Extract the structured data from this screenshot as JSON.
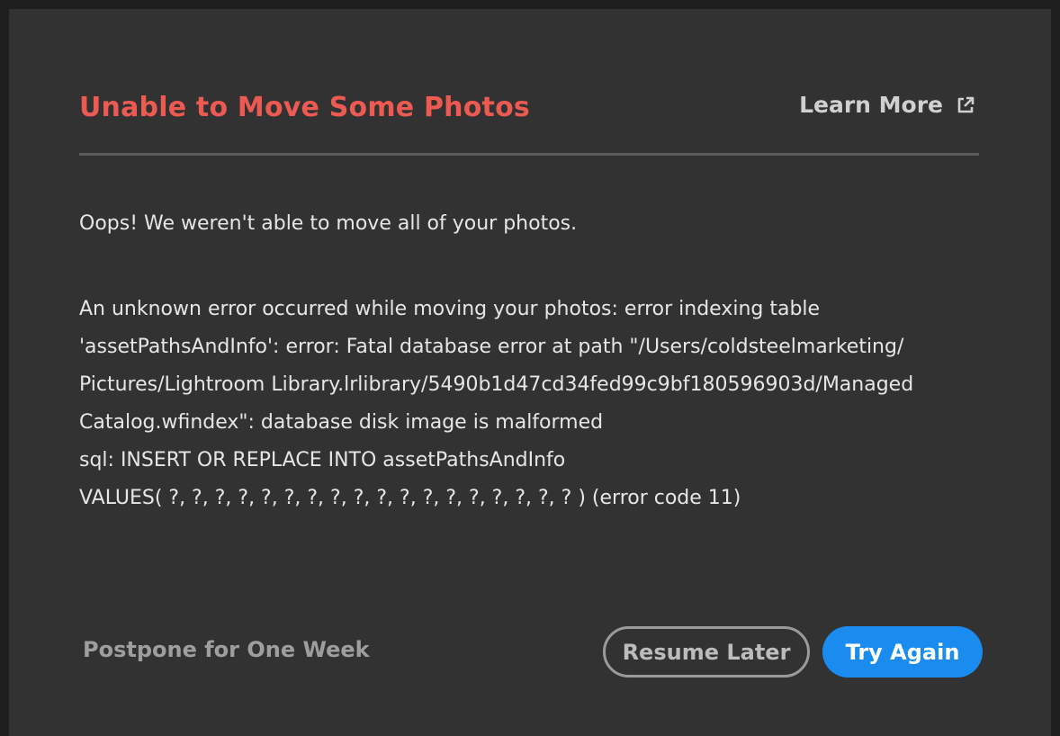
{
  "dialog": {
    "title": "Unable to Move Some Photos",
    "learn_more_label": "Learn More",
    "learn_more_icon": "external-link-icon",
    "intro": "Oops! We weren't able to move all of your photos.",
    "error_message": "An unknown error occurred while moving your photos: error indexing table\n'assetPathsAndInfo': error: Fatal database error at path \"/Users/coldsteelmarketing/\nPictures/Lightroom Library.lrlibrary/5490b1d47cd34fed99c9bf180596903d/Managed\nCatalog.wfindex\": database disk image is malformed\n  sql: INSERT OR REPLACE INTO assetPathsAndInfo\nVALUES( ?, ?, ?, ?, ?, ?, ?, ?, ?, ?, ?, ?, ?, ?, ?, ?, ?, ? ) (error code 11)",
    "postpone_label": "Postpone for One Week",
    "resume_later_label": "Resume Later",
    "try_again_label": "Try Again"
  },
  "colors": {
    "title": "#ec5a52",
    "primary_button": "#1a8cf0",
    "background": "#323232"
  }
}
